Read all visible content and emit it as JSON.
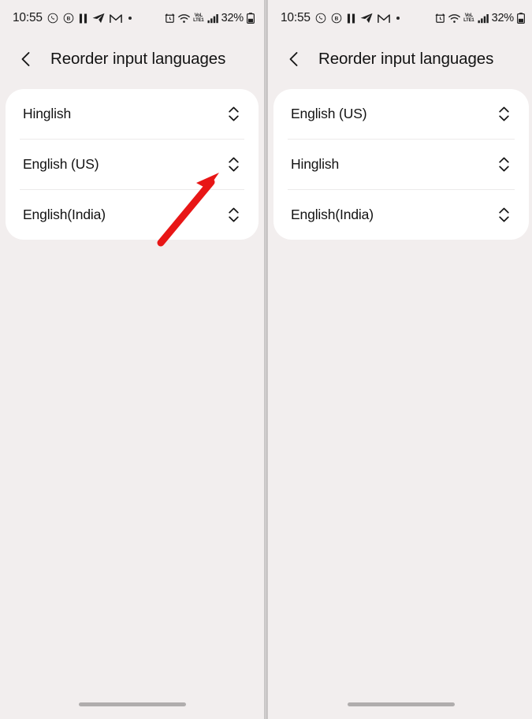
{
  "status_bar": {
    "time": "10:55",
    "left_icons": [
      "whatsapp-icon",
      "circled-b-icon",
      "pause-icon",
      "telegram-icon",
      "gmail-icon",
      "dot-icon"
    ],
    "right_icons": [
      "alarm-icon",
      "wifi-icon",
      "volte-icon",
      "signal-icon",
      "battery-icon"
    ],
    "volte_top": "VoL",
    "volte_bottom": "LTE1",
    "battery_percent": "32%"
  },
  "header": {
    "back_icon": "chevron-left-icon",
    "title": "Reorder input languages"
  },
  "panels": [
    {
      "name": "before",
      "languages": [
        {
          "label": "Hinglish",
          "handle": "reorder-handle-icon"
        },
        {
          "label": "English (US)",
          "handle": "reorder-handle-icon"
        },
        {
          "label": "English(India)",
          "handle": "reorder-handle-icon"
        }
      ],
      "annotation": {
        "type": "arrow",
        "color": "#e81616",
        "points_to": "English (US) reorder handle"
      }
    },
    {
      "name": "after",
      "languages": [
        {
          "label": "English (US)",
          "handle": "reorder-handle-icon"
        },
        {
          "label": "Hinglish",
          "handle": "reorder-handle-icon"
        },
        {
          "label": "English(India)",
          "handle": "reorder-handle-icon"
        }
      ]
    }
  ],
  "colors": {
    "page_background": "#f2eeee",
    "card_background": "#ffffff",
    "text_primary": "#131313",
    "divider": "#eceaea",
    "annotation_red": "#e81616",
    "gesture_bar": "#b0adad"
  },
  "gesture_bar": "home-indicator"
}
